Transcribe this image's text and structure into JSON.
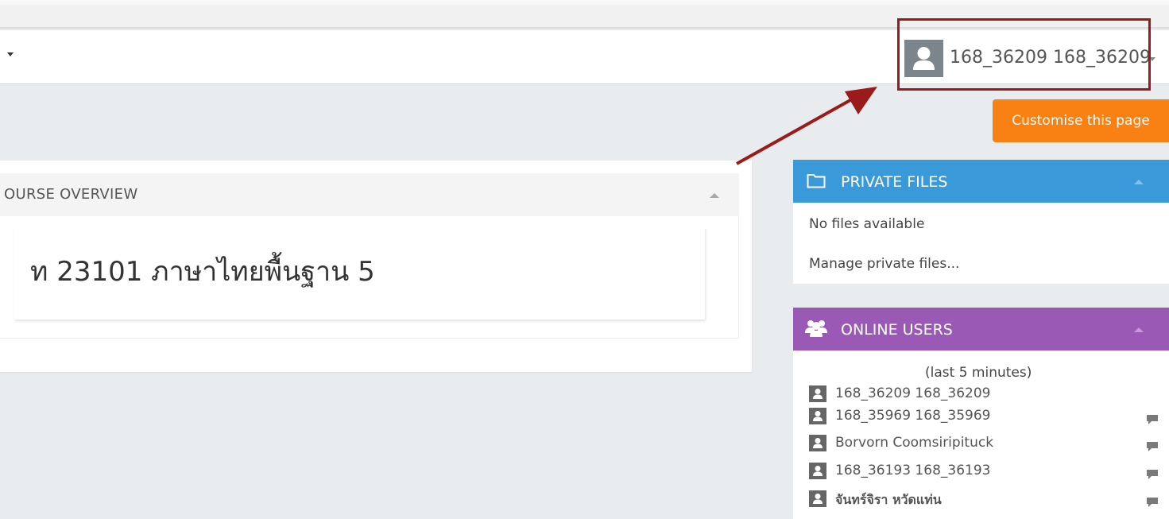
{
  "navbar": {
    "user_name": "168_36209 168_36209"
  },
  "customise_button": "Customise this page",
  "course_overview": {
    "title": "OURSE OVERVIEW",
    "course_name": "ท 23101 ภาษาไทยพื้นฐาน 5"
  },
  "private_files": {
    "title": "PRIVATE FILES",
    "empty_text": "No files available",
    "manage_link": "Manage private files..."
  },
  "online_users": {
    "title": "ONLINE USERS",
    "subtitle": "(last 5 minutes)",
    "users": [
      {
        "name": "168_36209 168_36209"
      },
      {
        "name": "168_35969 168_35969"
      },
      {
        "name": "Borvorn Coomsiripituck"
      },
      {
        "name": "168_36193 168_36193"
      },
      {
        "name": "จันทร์จิรา หวัดแท่น"
      }
    ]
  },
  "colors": {
    "private_files_header": "#3a9ad9",
    "online_users_header": "#9b59b6",
    "customise_button": "#f98012",
    "highlight_box": "#9b1b1b"
  }
}
